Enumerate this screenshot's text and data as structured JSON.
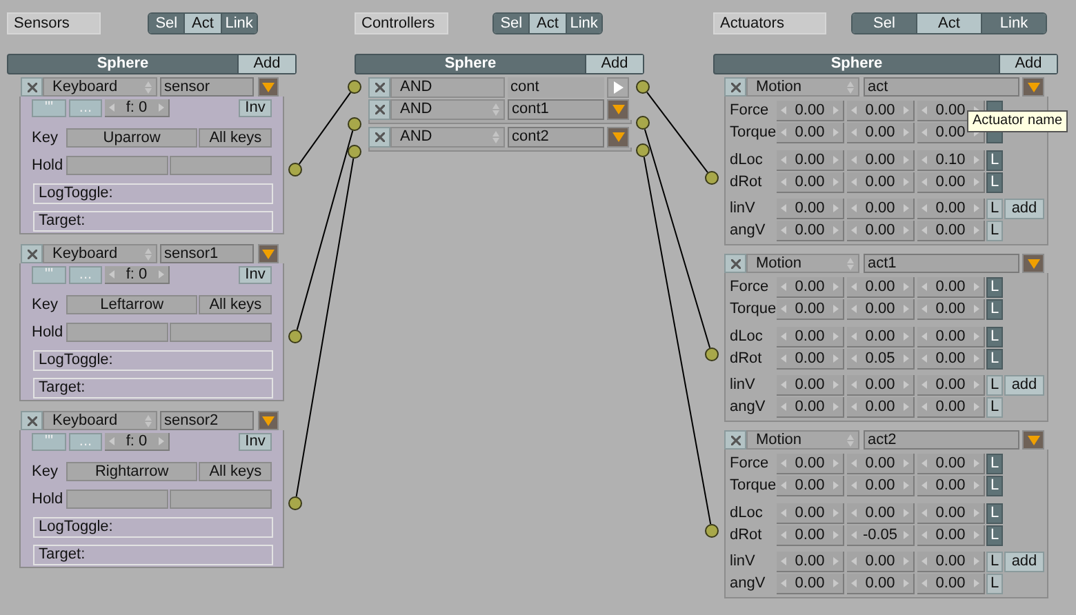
{
  "sensors": {
    "title": "Sensors",
    "filter": [
      {
        "label": "Sel",
        "selected": false
      },
      {
        "label": "Act",
        "selected": true
      },
      {
        "label": "Link",
        "selected": false
      }
    ],
    "object": "Sphere",
    "add_button": "Add",
    "items": [
      {
        "type": "Keyboard",
        "name": "sensor",
        "expanded": true,
        "pulse_buttons": [
          "'''",
          "..."
        ],
        "frequency": "f: 0",
        "invert": "Inv",
        "key_label": "Key",
        "key": "Uparrow",
        "all_keys": "All keys",
        "hold_label": "Hold",
        "log_toggle": "LogToggle:",
        "target": "Target:"
      },
      {
        "type": "Keyboard",
        "name": "sensor1",
        "expanded": true,
        "pulse_buttons": [
          "'''",
          "..."
        ],
        "frequency": "f: 0",
        "invert": "Inv",
        "key_label": "Key",
        "key": "Leftarrow",
        "all_keys": "All keys",
        "hold_label": "Hold",
        "log_toggle": "LogToggle:",
        "target": "Target:"
      },
      {
        "type": "Keyboard",
        "name": "sensor2",
        "expanded": true,
        "pulse_buttons": [
          "'''",
          "..."
        ],
        "frequency": "f: 0",
        "invert": "Inv",
        "key_label": "Key",
        "key": "Rightarrow",
        "all_keys": "All keys",
        "hold_label": "Hold",
        "log_toggle": "LogToggle:",
        "target": "Target:"
      }
    ]
  },
  "controllers": {
    "title": "Controllers",
    "filter": [
      {
        "label": "Sel",
        "selected": false
      },
      {
        "label": "Act",
        "selected": true
      },
      {
        "label": "Link",
        "selected": false
      }
    ],
    "object": "Sphere",
    "add_button": "Add",
    "items": [
      {
        "type": "AND",
        "name": "cont",
        "expanded": false
      },
      {
        "type": "AND",
        "name": "cont1",
        "expanded": true
      },
      {
        "type": "AND",
        "name": "cont2",
        "expanded": true
      }
    ]
  },
  "actuators": {
    "title": "Actuators",
    "filter": [
      {
        "label": "Sel",
        "selected": false
      },
      {
        "label": "Act",
        "selected": true
      },
      {
        "label": "Link",
        "selected": false
      }
    ],
    "object": "Sphere",
    "add_button": "Add",
    "tooltip": "Actuator name",
    "items": [
      {
        "type": "Motion",
        "name": "act",
        "expanded": true,
        "rows": [
          {
            "label": "Force",
            "values": [
              "0.00",
              "0.00",
              "0.00"
            ],
            "local": true
          },
          {
            "label": "Torque",
            "values": [
              "0.00",
              "0.00",
              "0.00"
            ],
            "local": true
          },
          {
            "label": "dLoc",
            "values": [
              "0.00",
              "0.00",
              "0.10"
            ],
            "local": true,
            "local_label": "L"
          },
          {
            "label": "dRot",
            "values": [
              "0.00",
              "0.00",
              "0.00"
            ],
            "local": true,
            "local_label": "L"
          },
          {
            "label": "linV",
            "values": [
              "0.00",
              "0.00",
              "0.00"
            ],
            "local": false,
            "local_label": "L",
            "add_button": "add"
          },
          {
            "label": "angV",
            "values": [
              "0.00",
              "0.00",
              "0.00"
            ],
            "local": false,
            "local_label": "L"
          }
        ]
      },
      {
        "type": "Motion",
        "name": "act1",
        "expanded": true,
        "rows": [
          {
            "label": "Force",
            "values": [
              "0.00",
              "0.00",
              "0.00"
            ],
            "local": true,
            "local_label": "L"
          },
          {
            "label": "Torque",
            "values": [
              "0.00",
              "0.00",
              "0.00"
            ],
            "local": true,
            "local_label": "L"
          },
          {
            "label": "dLoc",
            "values": [
              "0.00",
              "0.00",
              "0.00"
            ],
            "local": true,
            "local_label": "L"
          },
          {
            "label": "dRot",
            "values": [
              "0.00",
              "0.05",
              "0.00"
            ],
            "local": true,
            "local_label": "L"
          },
          {
            "label": "linV",
            "values": [
              "0.00",
              "0.00",
              "0.00"
            ],
            "local": false,
            "local_label": "L",
            "add_button": "add"
          },
          {
            "label": "angV",
            "values": [
              "0.00",
              "0.00",
              "0.00"
            ],
            "local": false,
            "local_label": "L"
          }
        ]
      },
      {
        "type": "Motion",
        "name": "act2",
        "expanded": true,
        "rows": [
          {
            "label": "Force",
            "values": [
              "0.00",
              "0.00",
              "0.00"
            ],
            "local": true,
            "local_label": "L"
          },
          {
            "label": "Torque",
            "values": [
              "0.00",
              "0.00",
              "0.00"
            ],
            "local": true,
            "local_label": "L"
          },
          {
            "label": "dLoc",
            "values": [
              "0.00",
              "0.00",
              "0.00"
            ],
            "local": true,
            "local_label": "L"
          },
          {
            "label": "dRot",
            "values": [
              "0.00",
              "-0.05",
              "0.00"
            ],
            "local": true,
            "local_label": "L"
          },
          {
            "label": "linV",
            "values": [
              "0.00",
              "0.00",
              "0.00"
            ],
            "local": false,
            "local_label": "L",
            "add_button": "add"
          },
          {
            "label": "angV",
            "values": [
              "0.00",
              "0.00",
              "0.00"
            ],
            "local": false,
            "local_label": "L"
          }
        ]
      }
    ]
  }
}
